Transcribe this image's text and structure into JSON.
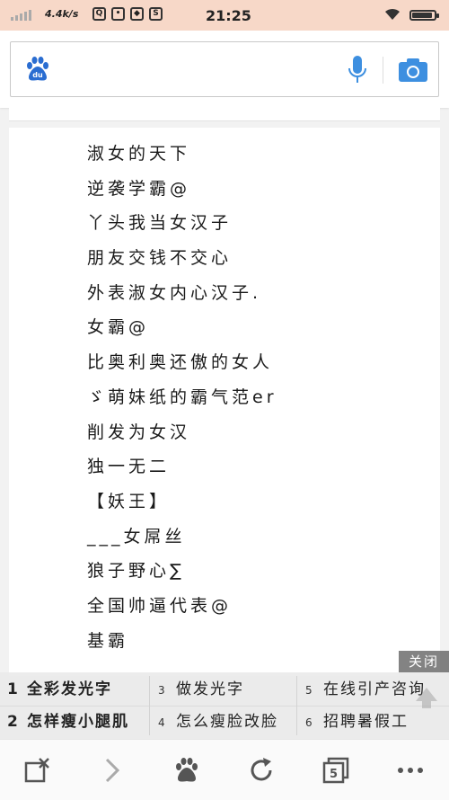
{
  "status_bar": {
    "network_speed": "4.4k/s",
    "time": "21:25",
    "app_icons": [
      "qq-icon",
      "message-icon",
      "shield-icon",
      "s-app-icon"
    ],
    "battery_level": 0.9
  },
  "search": {
    "placeholder": "",
    "logo_text": "du",
    "icons": [
      "baidu-paw-icon",
      "microphone-icon",
      "camera-icon"
    ],
    "accent_color": "#3d8fe0"
  },
  "article": {
    "names": [
      "淑女的天下",
      "逆袭学霸@",
      "丫头我当女汉子",
      "朋友交钱不交心",
      "外表淑女内心汉子.",
      "女霸@",
      "比奥利奥还傲的女人",
      "ゞ萌妹纸的霸气范er",
      "削发为女汉",
      "独一无二",
      "【妖王】",
      "___女屌丝",
      "狼子野心∑",
      "全国帅逼代表@",
      "基霸"
    ]
  },
  "suggestions": {
    "close_label": "关闭",
    "items": [
      {
        "rank": "1",
        "text": "全彩发光字"
      },
      {
        "rank": "3",
        "text": "做发光字"
      },
      {
        "rank": "5",
        "text": "在线引产咨询"
      },
      {
        "rank": "2",
        "text": "怎样瘦小腿肌"
      },
      {
        "rank": "4",
        "text": "怎么瘦脸改脸"
      },
      {
        "rank": "6",
        "text": "招聘暑假工"
      }
    ]
  },
  "toolbar": {
    "tab_count": "5",
    "icons": [
      "close-page-icon",
      "forward-icon",
      "baidu-home-icon",
      "refresh-icon",
      "tabs-icon",
      "more-icon"
    ]
  }
}
